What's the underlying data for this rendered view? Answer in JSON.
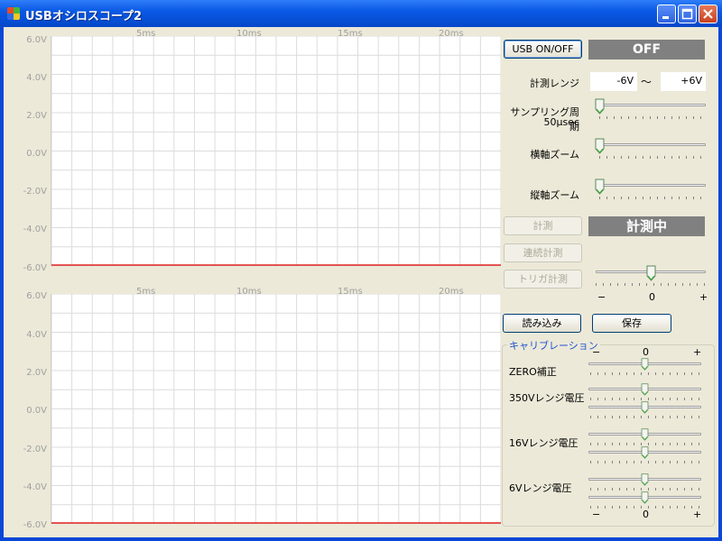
{
  "window": {
    "title": "USBオシロスコープ2",
    "icon": "app-grid-icon"
  },
  "scope": {
    "y_ticks": [
      "6.0V",
      "4.0V",
      "2.0V",
      "0.0V",
      "-2.0V",
      "-4.0V",
      "-6.0V"
    ],
    "x_ticks": [
      "5ms",
      "10ms",
      "15ms",
      "20ms"
    ],
    "trace_color": "#e02020",
    "grid_color": "#dcdcdc"
  },
  "controls": {
    "usb_button": "USB ON/OFF",
    "usb_status": "OFF",
    "range_label": "計測レンジ",
    "range_min": "-6V",
    "range_sep": "～",
    "range_max": "+6V",
    "sampling_label_1": "サンプリング周期",
    "sampling_label_2": "50μsec",
    "h_zoom_label": "横軸ズーム",
    "v_zoom_label": "縦軸ズーム",
    "measure_button": "計測",
    "measure_status": "計測中",
    "continuous_button": "連続計測",
    "trigger_button": "トリガ計測",
    "trigger_minus": "−",
    "trigger_zero": "0",
    "trigger_plus": "+",
    "load_button": "読み込み",
    "save_button": "保存"
  },
  "calibration": {
    "legend": "キャリブレーション",
    "minus": "−",
    "zero": "0",
    "plus": "+",
    "zero_label": "ZERO補正",
    "r350_label": "350Vレンジ電圧",
    "r16_label": "16Vレンジ電圧",
    "r6_label": "6Vレンジ電圧"
  }
}
